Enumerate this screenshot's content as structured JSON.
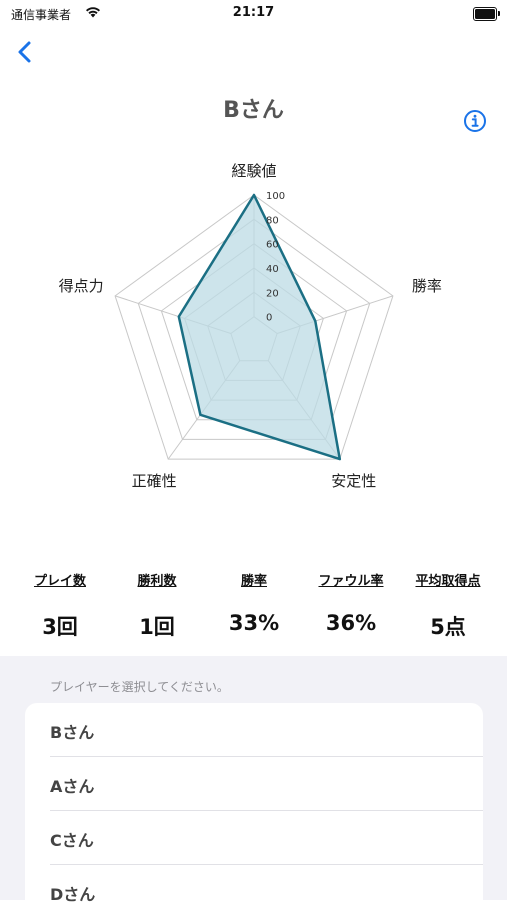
{
  "status_bar": {
    "carrier": "通信事業者",
    "time": "21:17",
    "icons": [
      "wifi-icon",
      "battery-icon"
    ]
  },
  "nav": {
    "back_icon": "chevron-left-icon",
    "info_icon": "info-circle-icon",
    "accent_color": "#1a73e8"
  },
  "page_title": "Bさん",
  "radar_chart": {
    "axes": [
      "経験値",
      "勝率",
      "安定性",
      "正確性",
      "得点力"
    ],
    "scale": [
      "0",
      "20",
      "40",
      "60",
      "80",
      "100"
    ],
    "values": [
      100,
      33,
      100,
      55,
      45
    ],
    "max": 100,
    "stroke_color": "#1b6f84",
    "fill_color": "#bcdbe4"
  },
  "chart_data": {
    "type": "radar",
    "categories": [
      "経験値",
      "勝率",
      "安定性",
      "正確性",
      "得点力"
    ],
    "series": [
      {
        "values": [
          100,
          33,
          100,
          55,
          45
        ]
      }
    ],
    "ylim": [
      0,
      100
    ],
    "ticks": [
      0,
      20,
      40,
      60,
      80,
      100
    ]
  },
  "stats": [
    {
      "label": "プレイ数",
      "value": "3回"
    },
    {
      "label": "勝利数",
      "value": "1回"
    },
    {
      "label": "勝率",
      "value": "33%"
    },
    {
      "label": "ファウル率",
      "value": "36%"
    },
    {
      "label": "平均取得点",
      "value": "5点"
    }
  ],
  "picker": {
    "hint": "プレイヤーを選択してください。",
    "players": [
      "Bさん",
      "Aさん",
      "Cさん",
      "Dさん"
    ]
  }
}
